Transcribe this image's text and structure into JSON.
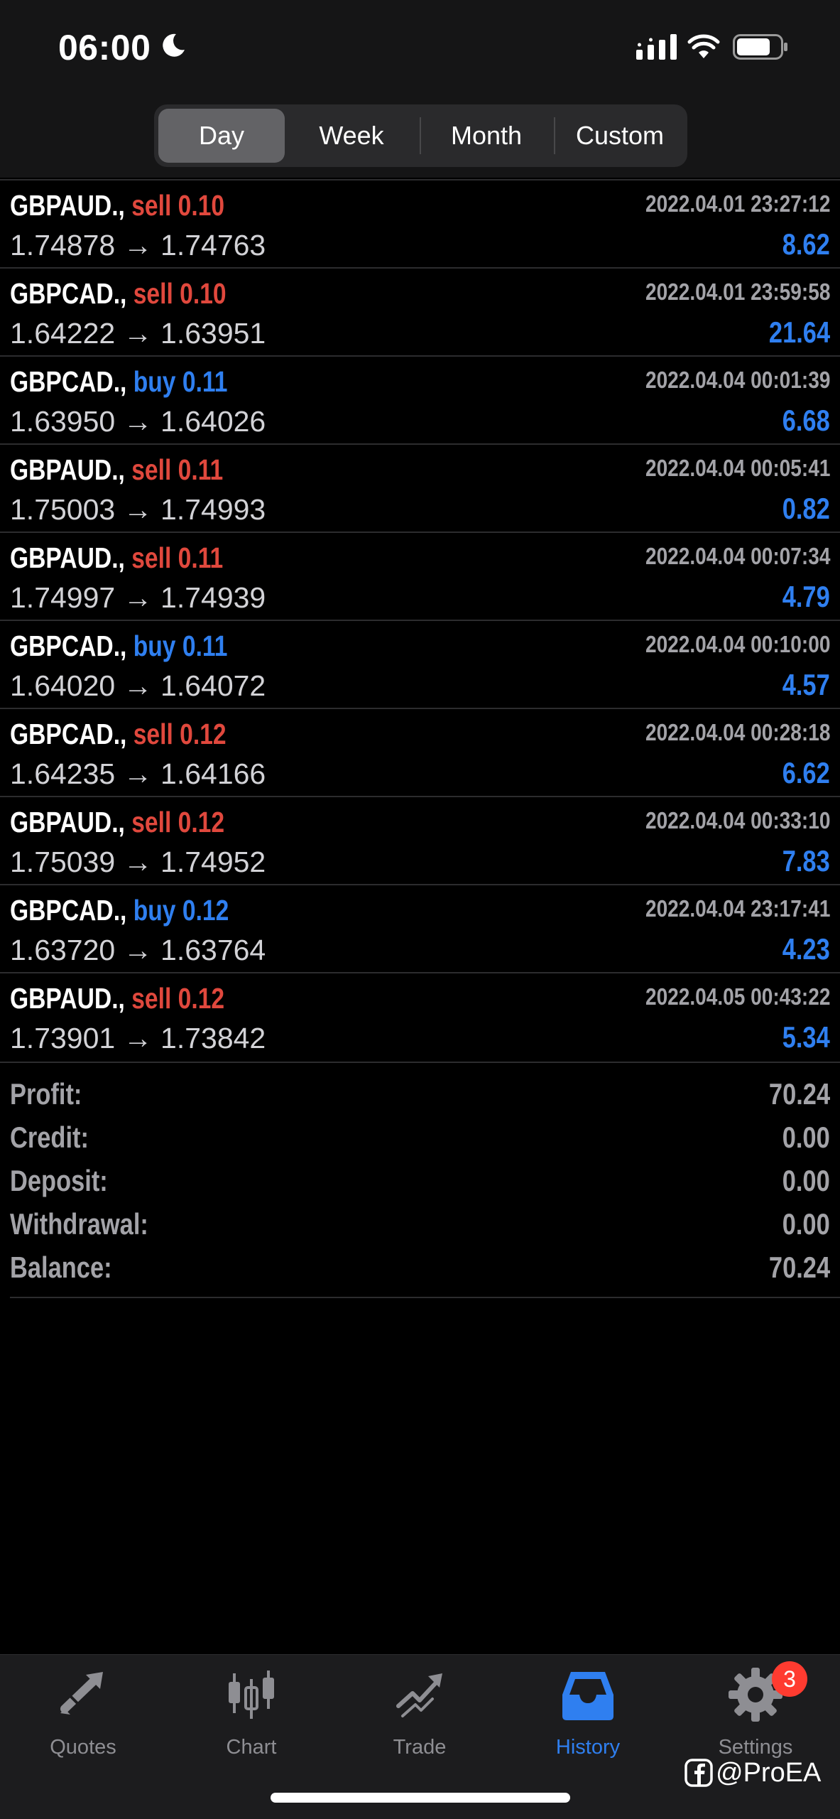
{
  "status_bar": {
    "time": "06:00",
    "icons": [
      "moon-icon",
      "cellular-signal-icon",
      "wifi-icon",
      "battery-icon"
    ]
  },
  "period_tabs": {
    "options": [
      "Day",
      "Week",
      "Month",
      "Custom"
    ],
    "selected": "Day"
  },
  "trades": [
    {
      "symbol": "GBPAUD.,",
      "side": "sell",
      "volume": "0.10",
      "time": "2022.04.01 23:27:12",
      "open_price": "1.74878",
      "close_price": "1.74763",
      "profit": "8.62"
    },
    {
      "symbol": "GBPCAD.,",
      "side": "sell",
      "volume": "0.10",
      "time": "2022.04.01 23:59:58",
      "open_price": "1.64222",
      "close_price": "1.63951",
      "profit": "21.64"
    },
    {
      "symbol": "GBPCAD.,",
      "side": "buy",
      "volume": "0.11",
      "time": "2022.04.04 00:01:39",
      "open_price": "1.63950",
      "close_price": "1.64026",
      "profit": "6.68"
    },
    {
      "symbol": "GBPAUD.,",
      "side": "sell",
      "volume": "0.11",
      "time": "2022.04.04 00:05:41",
      "open_price": "1.75003",
      "close_price": "1.74993",
      "profit": "0.82"
    },
    {
      "symbol": "GBPAUD.,",
      "side": "sell",
      "volume": "0.11",
      "time": "2022.04.04 00:07:34",
      "open_price": "1.74997",
      "close_price": "1.74939",
      "profit": "4.79"
    },
    {
      "symbol": "GBPCAD.,",
      "side": "buy",
      "volume": "0.11",
      "time": "2022.04.04 00:10:00",
      "open_price": "1.64020",
      "close_price": "1.64072",
      "profit": "4.57"
    },
    {
      "symbol": "GBPCAD.,",
      "side": "sell",
      "volume": "0.12",
      "time": "2022.04.04 00:28:18",
      "open_price": "1.64235",
      "close_price": "1.64166",
      "profit": "6.62"
    },
    {
      "symbol": "GBPAUD.,",
      "side": "sell",
      "volume": "0.12",
      "time": "2022.04.04 00:33:10",
      "open_price": "1.75039",
      "close_price": "1.74952",
      "profit": "7.83"
    },
    {
      "symbol": "GBPCAD.,",
      "side": "buy",
      "volume": "0.12",
      "time": "2022.04.04 23:17:41",
      "open_price": "1.63720",
      "close_price": "1.63764",
      "profit": "4.23"
    },
    {
      "symbol": "GBPAUD.,",
      "side": "sell",
      "volume": "0.12",
      "time": "2022.04.05 00:43:22",
      "open_price": "1.73901",
      "close_price": "1.73842",
      "profit": "5.34"
    }
  ],
  "price_arrow": "→",
  "summary": [
    {
      "label": "Profit:",
      "value": "70.24"
    },
    {
      "label": "Credit:",
      "value": "0.00"
    },
    {
      "label": "Deposit:",
      "value": "0.00"
    },
    {
      "label": "Withdrawal:",
      "value": "0.00"
    },
    {
      "label": "Balance:",
      "value": "70.24"
    }
  ],
  "tabbar": {
    "items": [
      {
        "label": "Quotes",
        "icon": "quotes-icon"
      },
      {
        "label": "Chart",
        "icon": "chart-icon"
      },
      {
        "label": "Trade",
        "icon": "trade-icon"
      },
      {
        "label": "History",
        "icon": "history-icon",
        "active": true
      },
      {
        "label": "Settings",
        "icon": "settings-icon"
      }
    ],
    "settings_badge": "3"
  },
  "watermark": {
    "text": "@ProEA",
    "icon": "facebook-icon"
  },
  "colors": {
    "sell": "#e0483d",
    "buy": "#2f7ff0",
    "profit": "#2f7ff0",
    "active_tab": "#2f7ff0",
    "badge": "#ff3b30"
  }
}
